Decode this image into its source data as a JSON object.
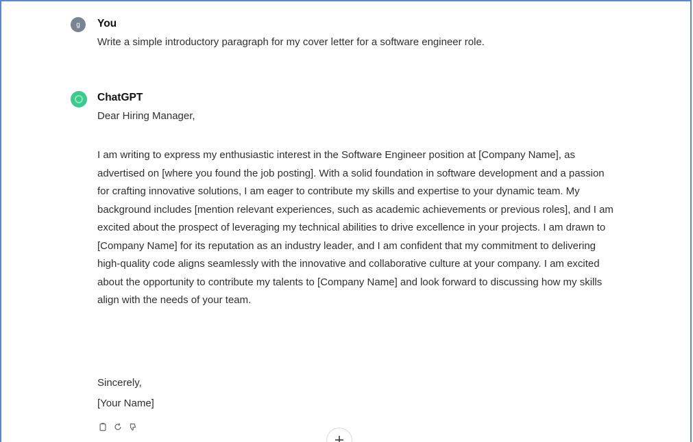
{
  "conversation": {
    "user": {
      "avatar_letter": "g",
      "name": "You",
      "message": "Write a simple introductory paragraph for my cover letter for a software engineer role."
    },
    "assistant": {
      "avatar_icon": "openai-logo-icon",
      "name": "ChatGPT",
      "greeting": "Dear Hiring Manager,",
      "paragraph": "I am writing to express my enthusiastic interest in the Software Engineer position at [Company Name], as advertised on [where you found the job posting]. With a solid foundation in software development and a passion for crafting innovative solutions, I am eager to contribute my skills and expertise to your dynamic team. My background includes [mention relevant experiences, such as academic achievements or previous roles], and I am excited about the prospect of leveraging my technical abilities to drive excellence in your projects. I am drawn to [Company Name] for its reputation as an industry leader, and I am confident that my commitment to delivering high-quality code aligns seamlessly with the innovative and collaborative culture at your company. I am excited about the opportunity to contribute my talents to [Company Name] and look forward to discussing how my skills align with the needs of your team.",
      "closing": "Sincerely,",
      "signature": "[Your Name]"
    },
    "actions": [
      "copy-icon",
      "regenerate-icon",
      "thumbs-down-icon"
    ],
    "scroll_button_icon": "arrow-down-icon"
  },
  "colors": {
    "frame_border": "#5b87c9",
    "assistant_avatar": "#19c37d",
    "user_avatar": "#7a8494"
  }
}
